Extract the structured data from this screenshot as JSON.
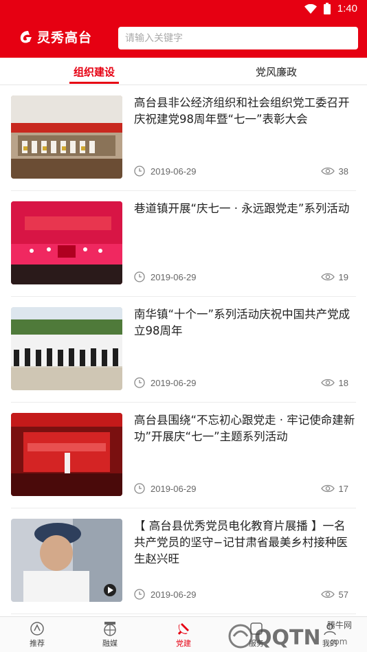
{
  "status": {
    "time": "1:40"
  },
  "app": {
    "title": "灵秀高台"
  },
  "search": {
    "placeholder": "请输入关键字"
  },
  "tabs": [
    {
      "label": "组织建设",
      "active": true
    },
    {
      "label": "党风廉政",
      "active": false
    }
  ],
  "articles": [
    {
      "title": "高台县非公经济组织和社会组织党工委召开庆祝建党98周年暨“七一”表彰大会",
      "date": "2019-06-29",
      "views": "38"
    },
    {
      "title": "巷道镇开展“庆七一 · 永远跟党走”系列活动",
      "date": "2019-06-29",
      "views": "19"
    },
    {
      "title": "南华镇“十个一”系列活动庆祝中国共产党成立98周年",
      "date": "2019-06-29",
      "views": "18"
    },
    {
      "title": "高台县围绕“不忘初心跟党走 · 牢记使命建新功”开展庆“七一”主题系列活动",
      "date": "2019-06-29",
      "views": "17"
    },
    {
      "title": "【 高台县优秀党员电化教育片展播 】一名共产党员的坚守−记甘肃省最美乡村接种医生赵兴旺",
      "date": "2019-06-29",
      "views": "57"
    }
  ],
  "bottom_nav": [
    {
      "label": "推荐"
    },
    {
      "label": "融媒"
    },
    {
      "label": "党建",
      "active": true
    },
    {
      "label": "服务"
    },
    {
      "label": "我的"
    }
  ],
  "watermark": {
    "text": "QQTN",
    "domain": ".com",
    "brand": "腾牛网"
  },
  "colors": {
    "brand": "#e60012",
    "text": "#222222",
    "meta": "#666666"
  }
}
